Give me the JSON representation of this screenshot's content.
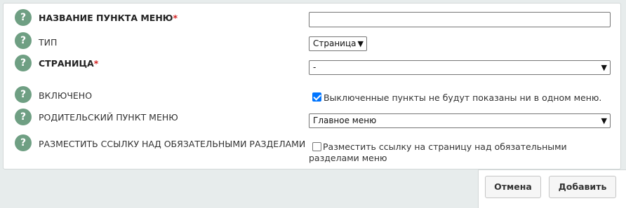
{
  "form": {
    "rows": [
      {
        "label": "НАЗВАНИЕ ПУНКТА МЕНЮ",
        "required_mark": "*"
      },
      {
        "label": "ТИП"
      },
      {
        "label": "СТРАНИЦА",
        "required_mark": "*"
      },
      {
        "label": "ВКЛЮЧЕНО"
      },
      {
        "label": "РОДИТЕЛЬСКИЙ ПУНКТ МЕНЮ"
      },
      {
        "label": "РАЗМЕСТИТЬ ССЫЛКУ НАД ОБЯЗАТЕЛЬНЫМИ РАЗДЕЛАМИ"
      }
    ],
    "help_glyph": "?",
    "name_value": "",
    "type_value": "Страница",
    "page_value": "-",
    "enabled_checked": true,
    "enabled_text": "Выключенные пункты не будут показаны ни в одном меню.",
    "parent_value": "Главное меню",
    "place_link_checked": false,
    "place_link_text": "Разместить ссылку на страницу над обязательными разделами меню"
  },
  "footer": {
    "cancel_label": "Отмена",
    "add_label": "Добавить"
  },
  "colors": {
    "help_icon": "#6f9f83",
    "required": "#d21f1f",
    "checkbox_checked": "#0075ff",
    "background": "#e7ecec"
  },
  "icons": {
    "help": "question-circle-icon",
    "dropdown": "chevron-down-icon"
  }
}
